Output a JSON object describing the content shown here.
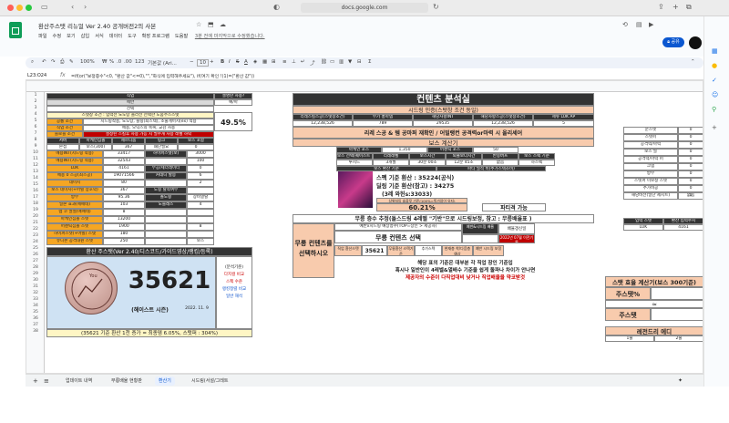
{
  "browser": {
    "url": "docs.google.com",
    "share_label": "공유"
  },
  "doc": {
    "title": "환산주스탯 리뉴얼 Ver 2.40 공개버전2의 사본",
    "menu": [
      "파일",
      "수정",
      "보기",
      "삽입",
      "서식",
      "데이터",
      "도구",
      "확장 프로그램",
      "도움말"
    ],
    "read_only_note": "3분 전에 마지막으로 수정했습니다."
  },
  "toolbar": {
    "zoom": "100%",
    "currency": "₩",
    "percent": "%",
    "decimal_dec": ".0",
    "decimal_inc": ".00",
    "number_fmt": "123",
    "font": "기본값 (Ari...",
    "font_size": "10",
    "bold": "B",
    "italic": "I",
    "strike": "S",
    "underline_a": "A"
  },
  "formula": {
    "cell_ref": "L23:O24",
    "content": "=if(or(\"보정증수\"<0, \"환산 값\"<=0),\"\",\"화식에 입력해주세요\"), if(여기 확인 !(1)=(\"환산 값\"))"
  },
  "left_block": {
    "title_job": "직업",
    "class_label": "에반",
    "select_label": "선택",
    "header_stat": "스탯창 조건 : 입력전 노도탕 플러전 선택한 도움주스스탯",
    "rows": [
      {
        "k": "공통 조건",
        "v": "시드링착용, 노도탕, 플링(최스텍), 소울게이지(ex) 적용"
      },
      {
        "k": "직업 조건",
        "v": "메용, 오닉스의 축복, 교감 사용"
      },
      {
        "k": "블로블 조건",
        "v": "설정된 스킬후 사용 가능 시 필수개 사용 레벨 하락"
      }
    ],
    "stat_headers": [
      "서버",
      "아케인심볼",
      "세르니움",
      "링크",
      "보스 포함"
    ],
    "stat_values": [
      "본섭",
      "보스(300)",
      "367",
      "왜단필요",
      "0"
    ],
    "rows2": [
      {
        "k": "메용INT(시드링 착용)",
        "v": "33417",
        "k2": "하이퍼스탯(보)",
        "v2": "3000"
      },
      {
        "k": "메용INT(시드링 적용)",
        "v": "32543",
        "k2": "",
        "v2": "100"
      },
      {
        "k": "LUK",
        "v": "4161",
        "k2": "무공/제너레이터",
        "v2": "0"
      },
      {
        "k": "메용 0 스공(최스공)",
        "v": "19071566",
        "k2": "커데니 할증",
        "v2": "6"
      },
      {
        "k": "데미지",
        "v": "80",
        "k2": "",
        "v2": "2"
      },
      {
        "k": "보스 데미지(+어빌 상호약)",
        "v": "367",
        "k2": "도핑 탈착여부",
        "v2": ""
      },
      {
        "k": "방무",
        "v": "95.36",
        "k2": "폴도핑",
        "v2": "장비열탈"
      },
      {
        "k": "일본 효과(애매테)",
        "v": "103",
        "k2": "노블레스",
        "v2": "4"
      },
      {
        "k": "렙 코 멸절(애매테)",
        "v": "8",
        "k2": "",
        "v2": ""
      },
      {
        "k": "아케인심볼 스텟",
        "v": "13200",
        "k2": "",
        "v2": ""
      },
      {
        "k": "어센틱심볼 스텟",
        "v": "1900",
        "k2": "",
        "v2": "8"
      },
      {
        "k": "하이퍼스텟(+어빌) 스탯",
        "v": "180",
        "k2": "",
        "v2": ""
      },
      {
        "k": "유니온 공격대원 스텟",
        "v": "250",
        "k2": "",
        "v2": "보스"
      }
    ],
    "percent_label": "49.5%",
    "desc_label": "설명란 사용?",
    "ex_label": "예/아"
  },
  "main_stat": {
    "title": "환산 주스탯(Ver 2.40/디스코드/가이드영상/랭킹/등록)",
    "value": "35621",
    "season": "(헤이스트 시즌)",
    "date": "2022. 11. 9",
    "side_notes": [
      "(분석기준)",
      "다지컬 비교",
      "스펙 수준",
      "랭킹정렬 비교",
      "일반 해석"
    ],
    "footer": "(35621 기준 환산 1천 증가 = 최종뎀 6.05%, 스탯퍼 : 304%)"
  },
  "content_block": {
    "title": "컨텐츠 분석실",
    "sub_title": "시드링 인증(스탯창 조건 동일)",
    "headers": [
      "리레스킬스공(스탯창조건)",
      "무기 홍마뎀",
      "해당사항INT",
      "해당사항스공(스탯창조건)",
      "제뉴 LUK AP"
    ],
    "values": [
      "12,238,526",
      "789",
      "29535",
      "12,238,526",
      "5"
    ],
    "banner": "리레 스공 & 템 공마퍼 재확인 / 어빌랭컨 공격력or마력 시 올리세어",
    "boss_title": "보스 계산기",
    "boss_h1": [
      "아케인 포스",
      "1,350",
      "어센틱 포스",
      "50"
    ],
    "boss_h2": [
      "보스 선택(퀘이스트 기준)",
      "리레레벨",
      "보스시간",
      "퇴출보다시간",
      "반봉버프",
      "보스 스펙 기준"
    ],
    "boss_v2": [
      "루시드",
      "3개월",
      "30분 00초",
      "12분 45초",
      "없음",
      "하스펙"
    ],
    "boss_fav": "보스 환산 기준",
    "boss_fav2": "파티 딜적 비(추가스텍조비)",
    "skill_stats": [
      "스펙 기준 환산 : 35224(공식)",
      "딜링 기준 환산(참고) : 34275",
      "(3레 와헌s:33033)"
    ],
    "boss_ratio_label": "상위처입 솔플킷 기준(100%=뚝가없이 유지)",
    "ratio_value": "60.21%",
    "party_label": "파티격 가능",
    "est_title": "무릉 층수 추정(돌스드링 4레벨 \"기반\"으로 시드링보정, 참고 : 무릉배율표 )",
    "mureung_left": "무릉 컨텐츠를 선택하시오",
    "mureung_choice": "무릉 컨텐츠 선택",
    "mureung_header": "예반x시드링 예상층수(TOP=장인 > 제공자)",
    "mureung_h2": "예반&시드링 배율",
    "mureung_h3": "배율갱신일",
    "row_labels": [
      "직업 환산스텟",
      "35621",
      "무릉환산 스텍기준",
      "추가스텍",
      "현재층 착/다음층 예상",
      "예반 시드링 보정"
    ],
    "ana_year": "2022년 07월 이전기록",
    "note1": "해당 표의 기준은 대부분 각 직업 장인 기준입",
    "note2": "혹시나 일반인이 4레벨&멸배수 기준을 쉽게 돌파나 차이가 안나면",
    "note3": "제공자의 수준이 다직업대비 낮거나 직업배율을 약코받것"
  },
  "right_block": {
    "labels": [
      "순스텟",
      "스텟퍼",
      "공격력/마력",
      "보스 딜",
      "공격력/마력 퍼",
      "크뎀",
      "방무",
      "스텟퍼 미보정 스텟",
      "추가비공",
      "해당비전(일단 제시트)"
    ],
    "values": [
      "0",
      "0",
      "0",
      "0",
      "0",
      "0",
      "0",
      "0",
      "0",
      "0"
    ],
    "none_label": "없음",
    "input_h": [
      "입력 스텟",
      "환산 입력수치"
    ],
    "input_v": [
      "LUK",
      "4161"
    ],
    "eff_title": "스탯 효율 계산기(보스 300기준)",
    "eff_rows": [
      "주스탯%",
      "≈",
      "주스탯"
    ],
    "legend": "레전드리 에디",
    "legend_row": [
      "1줄",
      "2줄"
    ]
  },
  "sheet_tabs": [
    "업데이트 내역",
    "무릉배율 현황판",
    "환산기",
    "시드링(서설/그레트"
  ],
  "active_tab": "환산기",
  "side_panel_icons": [
    "calendar-icon",
    "keep-icon",
    "tasks-icon",
    "contacts-icon",
    "maps-icon",
    "add-icon"
  ]
}
